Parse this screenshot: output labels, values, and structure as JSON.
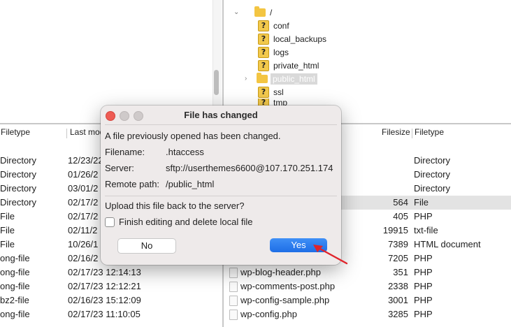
{
  "remote_tree": {
    "root_label": "/",
    "items": [
      {
        "label": "conf"
      },
      {
        "label": "local_backups"
      },
      {
        "label": "logs"
      },
      {
        "label": "private_html"
      },
      {
        "label": "public_html"
      },
      {
        "label": "ssl"
      },
      {
        "label": "tmp"
      }
    ]
  },
  "local_list": {
    "headers": {
      "filetype": "Filetype",
      "last_modified": "Last mod"
    },
    "rows": [
      {
        "type": "Directory",
        "modified": "12/23/22"
      },
      {
        "type": "Directory",
        "modified": "01/26/2"
      },
      {
        "type": "Directory",
        "modified": "03/01/2"
      },
      {
        "type": "Directory",
        "modified": "02/17/2"
      },
      {
        "type": "File",
        "modified": "02/17/2"
      },
      {
        "type": "File",
        "modified": "02/11/2"
      },
      {
        "type": "File",
        "modified": "10/26/1"
      },
      {
        "type": "ong-file",
        "modified": "02/16/2"
      },
      {
        "type": "ong-file",
        "modified": "02/17/23 12:14:13"
      },
      {
        "type": "ong-file",
        "modified": "02/17/23 12:12:21"
      },
      {
        "type": "bz2-file",
        "modified": "02/16/23 15:12:09"
      },
      {
        "type": "ong-file",
        "modified": "02/17/23 11:10:05"
      }
    ]
  },
  "remote_list": {
    "headers": {
      "filesize": "Filesize",
      "filetype": "Filetype"
    },
    "rows": [
      {
        "name": "",
        "size": "",
        "type": "Directory"
      },
      {
        "name": "",
        "size": "",
        "type": "Directory"
      },
      {
        "name": "",
        "size": "",
        "type": "Directory"
      },
      {
        "name": "",
        "size": "564",
        "type": "File",
        "selected": true
      },
      {
        "name": "",
        "size": "405",
        "type": "PHP"
      },
      {
        "name": "",
        "size": "19915",
        "type": "txt-file"
      },
      {
        "name": "",
        "size": "7389",
        "type": "HTML document"
      },
      {
        "name": "",
        "size": "7205",
        "type": "PHP"
      },
      {
        "name": "wp-blog-header.php",
        "size": "351",
        "type": "PHP"
      },
      {
        "name": "wp-comments-post.php",
        "size": "2338",
        "type": "PHP"
      },
      {
        "name": "wp-config-sample.php",
        "size": "3001",
        "type": "PHP"
      },
      {
        "name": "wp-config.php",
        "size": "3285",
        "type": "PHP"
      }
    ]
  },
  "dialog": {
    "title": "File has changed",
    "message": "A file previously opened has been changed.",
    "filename_label": "Filename:",
    "filename_value": ".htaccess",
    "server_label": "Server:",
    "server_value": "sftp://userthemes6600@107.170.251.174",
    "remote_path_label": "Remote path:",
    "remote_path_value": "/public_html",
    "question": "Upload this file back to the server?",
    "checkbox_label": "Finish editing and delete local file",
    "no_label": "No",
    "yes_label": "Yes"
  },
  "colors": {
    "accent_blue": "#1e6ee6",
    "selection": "#e3e3e3",
    "annotation_arrow": "#e0242b"
  }
}
